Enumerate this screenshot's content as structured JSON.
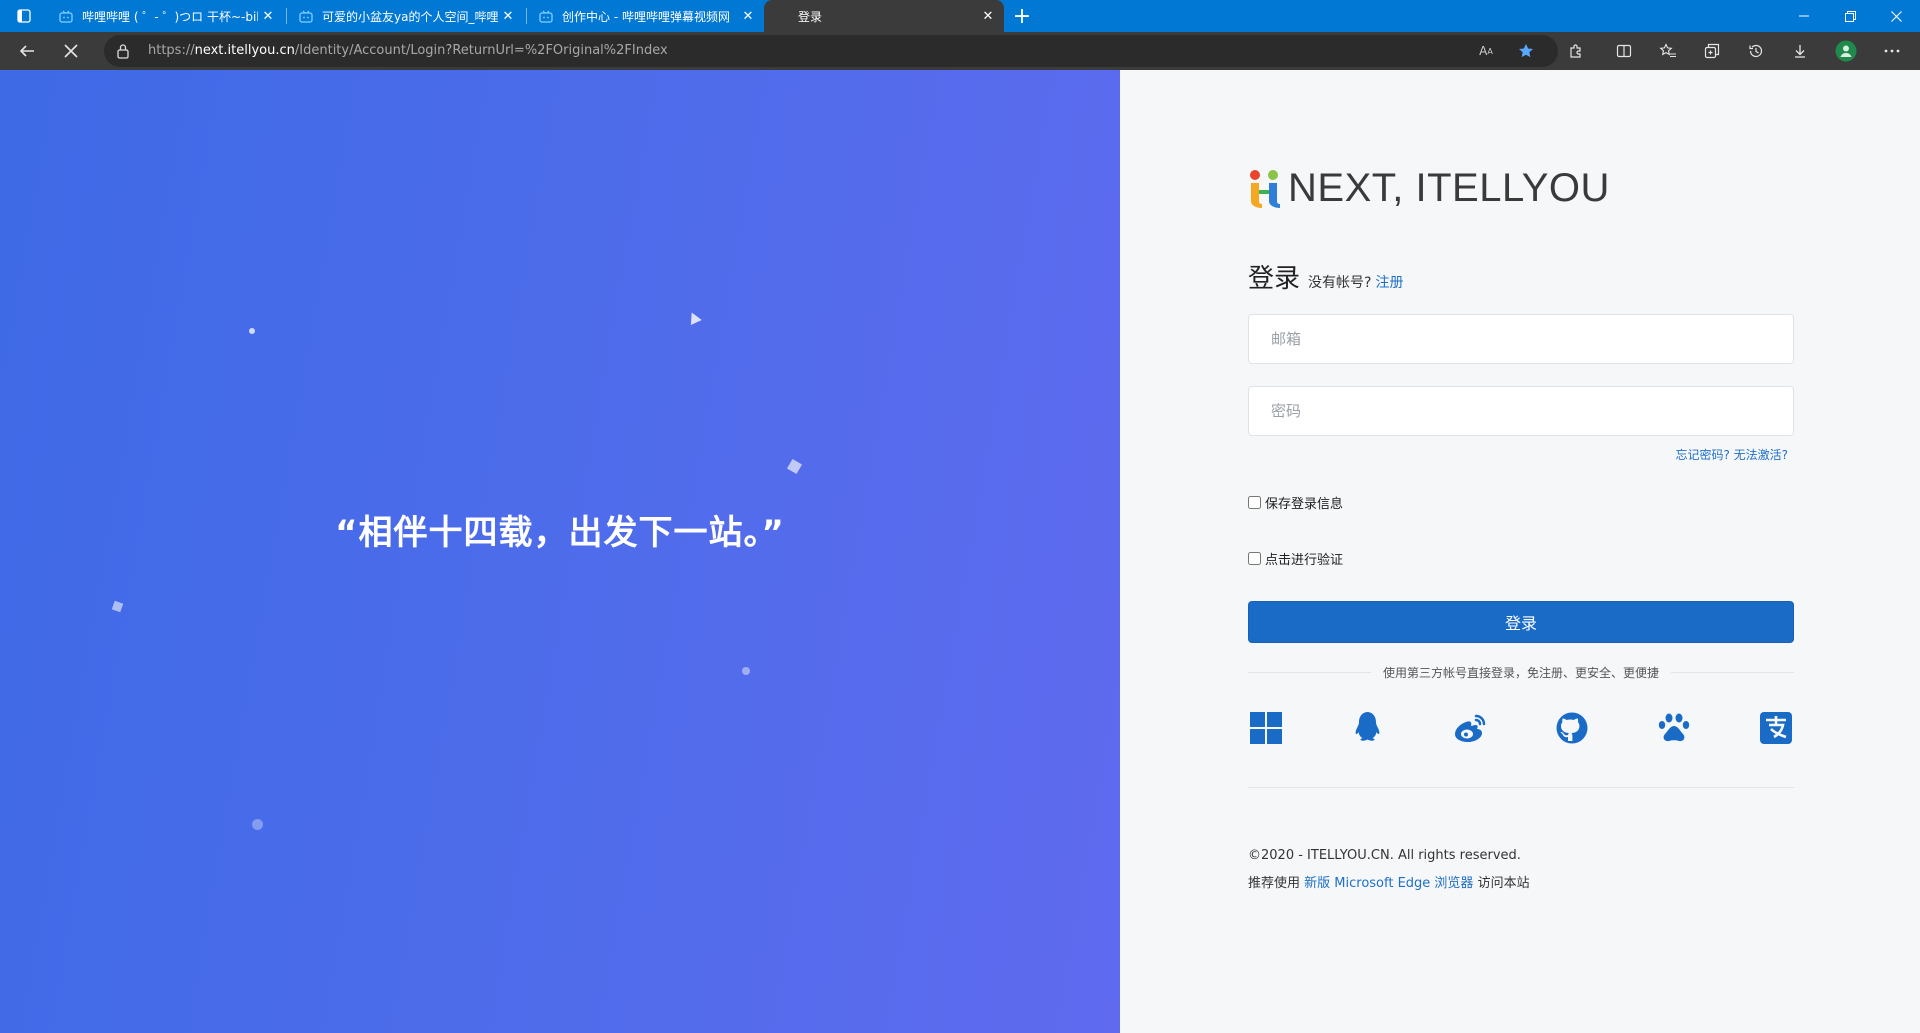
{
  "browser": {
    "tabs": [
      {
        "title": "哔哩哔哩 ( ゜- ゜)つロ 干杯~-bili",
        "active": false
      },
      {
        "title": "可爱的小盆友ya的个人空间_哔哩",
        "active": false
      },
      {
        "title": "创作中心 - 哔哩哔哩弹幕视频网",
        "active": false
      },
      {
        "title": "登录",
        "active": true
      }
    ],
    "url_scheme": "https://",
    "url_host": "next.itellyou.cn",
    "url_path": "/Identity/Account/Login?ReturnUrl=%2FOriginal%2FIndex",
    "read_aloud": "A",
    "accent": "#0078d4"
  },
  "hero": {
    "quote": "“相伴十四载，出发下一站。”"
  },
  "login": {
    "logo_text": "NEXT, ITELLYOU",
    "title": "登录",
    "no_account": "没有帐号?",
    "register": "注册",
    "email_placeholder": "邮箱",
    "password_placeholder": "密码",
    "forgot": "忘记密码? 无法激活?",
    "remember": "保存登录信息",
    "verify": "点击进行验证",
    "submit": "登录",
    "third_party": "使用第三方帐号直接登录，免注册、更安全、更便捷",
    "social_icons": [
      "windows-icon",
      "qq-icon",
      "weibo-icon",
      "github-icon",
      "baidu-icon",
      "alipay-icon"
    ]
  },
  "footer": {
    "copyright": "©2020 - ITELLYOU.CN. All rights reserved.",
    "recommend_prefix": "推荐使用",
    "recommend_link": "新版 Microsoft Edge 浏览器",
    "recommend_suffix": "访问本站"
  }
}
